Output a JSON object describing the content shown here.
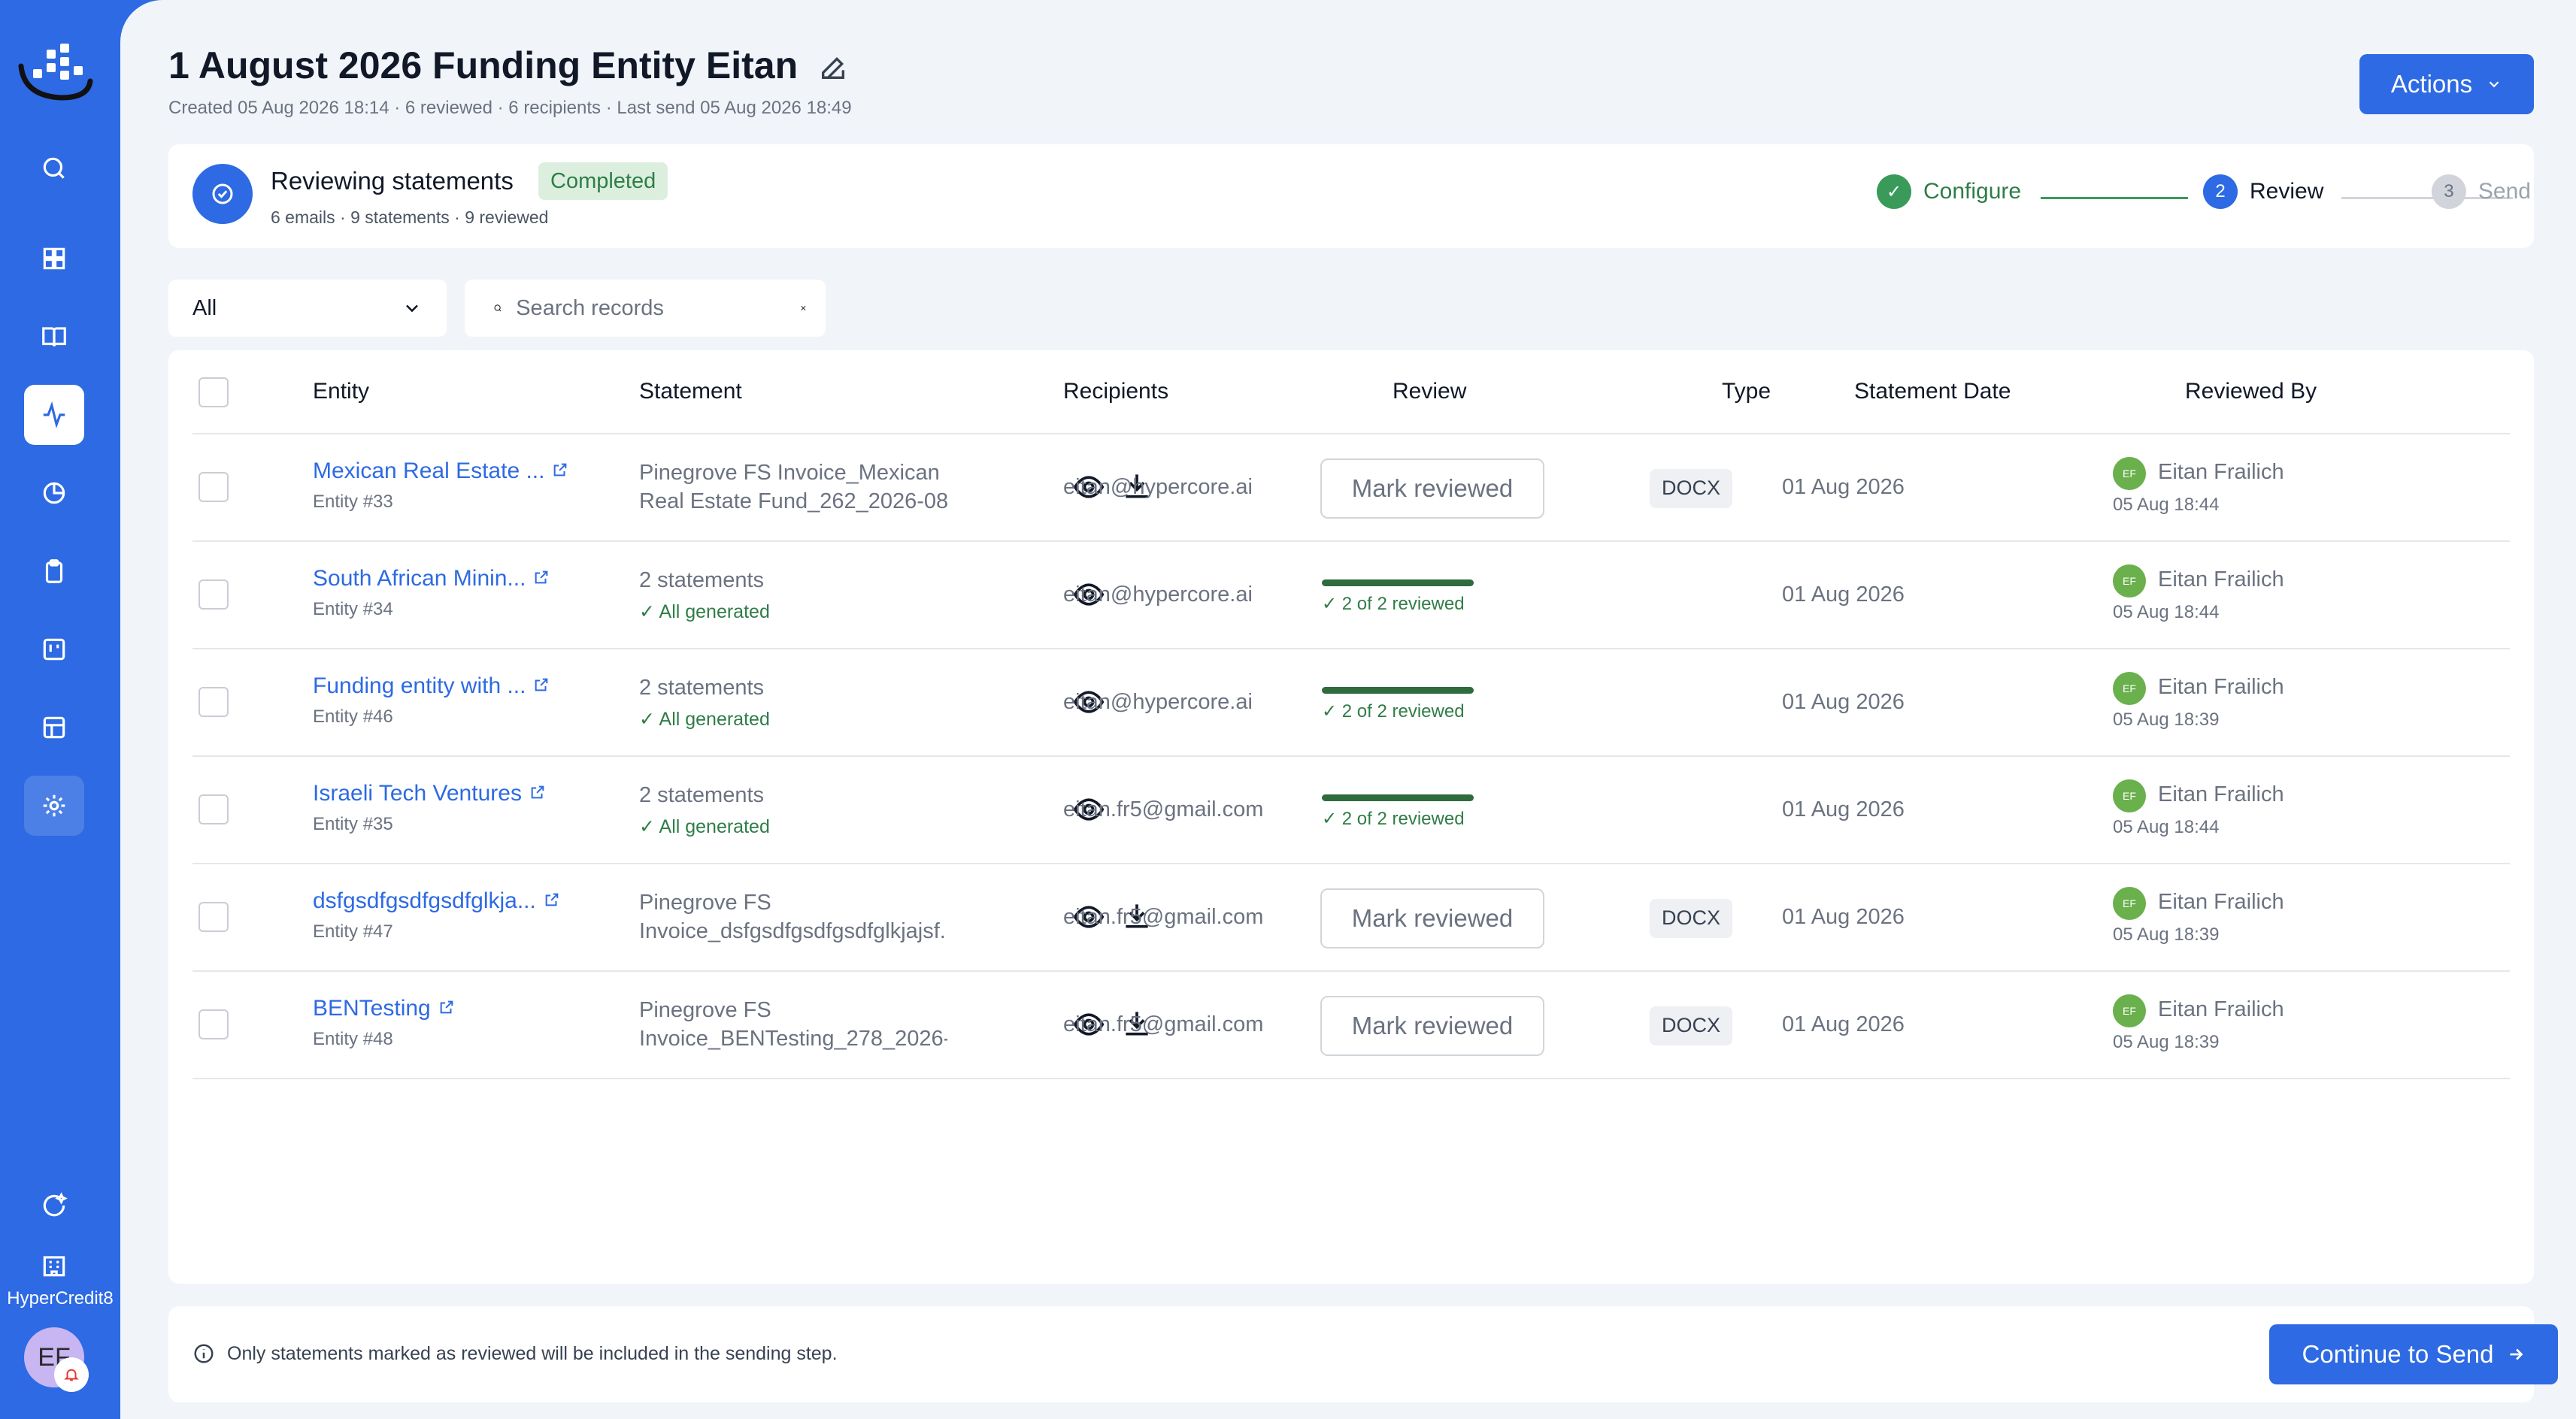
{
  "sidebar": {
    "org_name": "HyperCredit8",
    "user_initials": "EF",
    "items": [
      {
        "name": "search-icon"
      },
      {
        "name": "dashboard-icon"
      },
      {
        "name": "book-icon"
      },
      {
        "name": "activity-icon",
        "active": true
      },
      {
        "name": "pie-chart-icon"
      },
      {
        "name": "clipboard-icon"
      },
      {
        "name": "kanban-icon"
      },
      {
        "name": "table-icon"
      },
      {
        "name": "gear-icon"
      }
    ]
  },
  "header": {
    "title": "1 August 2026 Funding Entity Eitan",
    "subtitle": "Created 05 Aug 2026 18:14 · 6 reviewed · 6 recipients · Last send 05 Aug 2026 18:49",
    "actions_label": "Actions"
  },
  "status": {
    "title": "Reviewing statements",
    "badge": "Completed",
    "meta": "6 emails · 9 statements · 9 reviewed"
  },
  "stepper": {
    "steps": [
      {
        "label": "Configure",
        "number": "1",
        "state": "done"
      },
      {
        "label": "Review",
        "number": "2",
        "state": "current"
      },
      {
        "label": "Send",
        "number": "3",
        "state": "pending"
      }
    ]
  },
  "filters": {
    "select_value": "All",
    "search_placeholder": "Search records"
  },
  "table": {
    "columns": [
      "Entity",
      "Statement",
      "Recipients",
      "Review",
      "Type",
      "Statement Date",
      "Reviewed By"
    ],
    "rows": [
      {
        "entity": "Mexican Real Estate ...",
        "entity_id": "Entity #33",
        "statement_line1": "Pinegrove FS Invoice_Mexican",
        "statement_line2": "Real Estate Fund_262_2026-08...",
        "statement_generated": "",
        "recipient": "eitan@hypercore.ai",
        "review_button": "Mark reviewed",
        "review_progress": "",
        "review_fraction": null,
        "type": "DOCX",
        "date": "01 Aug 2026",
        "reviewer_initials": "EF",
        "reviewer": "Eitan Frailich",
        "reviewed_at": "05 Aug 18:44",
        "has_download": true
      },
      {
        "entity": "South African Minin...",
        "entity_id": "Entity #34",
        "statement_line1": "2 statements",
        "statement_line2": "",
        "statement_generated": "All generated",
        "recipient": "eitan@hypercore.ai",
        "review_button": "",
        "review_progress": "2 of 2 reviewed",
        "review_fraction": 1.0,
        "type": "",
        "date": "01 Aug 2026",
        "reviewer_initials": "EF",
        "reviewer": "Eitan Frailich",
        "reviewed_at": "05 Aug 18:44",
        "has_download": false
      },
      {
        "entity": "Funding entity with ...",
        "entity_id": "Entity #46",
        "statement_line1": "2 statements",
        "statement_line2": "",
        "statement_generated": "All generated",
        "recipient": "eitan@hypercore.ai",
        "review_button": "",
        "review_progress": "2 of 2 reviewed",
        "review_fraction": 1.0,
        "type": "",
        "date": "01 Aug 2026",
        "reviewer_initials": "EF",
        "reviewer": "Eitan Frailich",
        "reviewed_at": "05 Aug 18:39",
        "has_download": false
      },
      {
        "entity": "Israeli Tech Ventures",
        "entity_id": "Entity #35",
        "statement_line1": "2 statements",
        "statement_line2": "",
        "statement_generated": "All generated",
        "recipient": "eitan.fr5@gmail.com",
        "review_button": "",
        "review_progress": "2 of 2 reviewed",
        "review_fraction": 1.0,
        "type": "",
        "date": "01 Aug 2026",
        "reviewer_initials": "EF",
        "reviewer": "Eitan Frailich",
        "reviewed_at": "05 Aug 18:44",
        "has_download": false
      },
      {
        "entity": "dsfgsdfgsdfgsdfglkja...",
        "entity_id": "Entity #47",
        "statement_line1": "Pinegrove FS",
        "statement_line2": "Invoice_dsfgsdfgsdfgsdfglkjajsf...",
        "statement_generated": "",
        "recipient": "eitan.fr5@gmail.com",
        "review_button": "Mark reviewed",
        "review_progress": "",
        "review_fraction": null,
        "type": "DOCX",
        "date": "01 Aug 2026",
        "reviewer_initials": "EF",
        "reviewer": "Eitan Frailich",
        "reviewed_at": "05 Aug 18:39",
        "has_download": true
      },
      {
        "entity": "BENTesting",
        "entity_id": "Entity #48",
        "statement_line1": "Pinegrove FS",
        "statement_line2": "Invoice_BENTesting_278_2026-...",
        "statement_generated": "",
        "recipient": "eitan.fr5@gmail.com",
        "review_button": "Mark reviewed",
        "review_progress": "",
        "review_fraction": null,
        "type": "DOCX",
        "date": "01 Aug 2026",
        "reviewer_initials": "EF",
        "reviewer": "Eitan Frailich",
        "reviewed_at": "05 Aug 18:39",
        "has_download": true
      }
    ]
  },
  "footer": {
    "note": "Only statements marked as reviewed will be included in the sending step.",
    "continue_label": "Continue to Send"
  },
  "colors": {
    "primary": "#2d6ae3",
    "success": "#2f7d47",
    "progress": "#2f6b3d",
    "avatar_green": "#6ab04c"
  }
}
